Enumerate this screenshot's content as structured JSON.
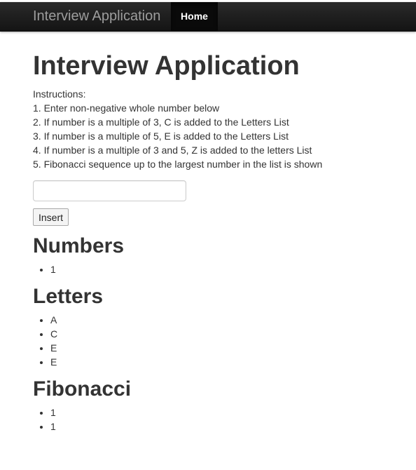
{
  "navbar": {
    "brand": "Interview Application",
    "home_label": "Home"
  },
  "page_title": "Interview Application",
  "instructions": [
    "Instructions:",
    "1. Enter non-negative whole number below",
    "2. If number is a multiple of 3, C is added to the Letters List",
    "3. If number is a multiple of 5, E is added to the Letters List",
    "4. If number is a multiple of 3 and 5, Z is added to the letters List",
    "5. Fibonacci sequence up to the largest number in the list is shown"
  ],
  "input": {
    "value": "",
    "placeholder": ""
  },
  "insert_button_label": "Insert",
  "numbers": {
    "heading": "Numbers",
    "items": [
      "1"
    ]
  },
  "letters": {
    "heading": "Letters",
    "items": [
      "A",
      "C",
      "E",
      "E"
    ]
  },
  "fibonacci": {
    "heading": "Fibonacci",
    "items": [
      "1",
      "1"
    ]
  },
  "colors": {
    "navbar_bg": "#1b1b1b",
    "brand_text": "#9d9d9d",
    "active_nav_bg": "#0a0a0a",
    "heading_text": "#333333"
  }
}
